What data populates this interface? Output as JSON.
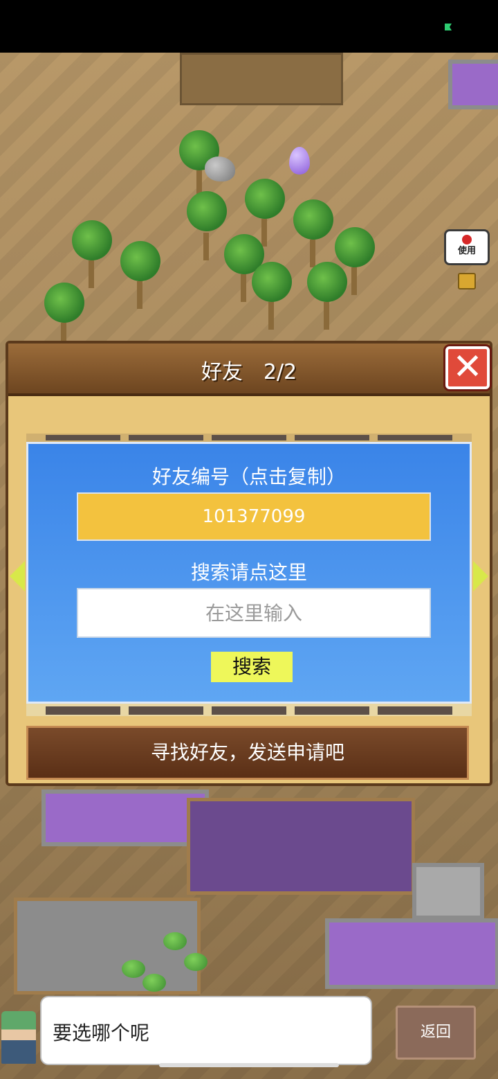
{
  "status_bar": {
    "battery_icon": "battery-charging-icon",
    "battery_color": "#2ecc71"
  },
  "map": {
    "use_item_label": "使用",
    "use_item_icon": "apple-icon",
    "lock_icon": "lock-icon",
    "egg_icon": "egg-icon"
  },
  "panel": {
    "title": "好友　2/2",
    "close_icon": "close-icon",
    "close_glyph": "✕",
    "prev_icon": "arrow-left-icon",
    "next_icon": "arrow-right-icon",
    "friend_id_label": "好友编号（点击复制）",
    "friend_id_value": "101377099",
    "search_label": "搜索请点这里",
    "search_placeholder": "在这里输入",
    "search_value": "",
    "search_button": "搜索",
    "find_friends_banner": "寻找好友，发送申请吧"
  },
  "dialog": {
    "text": "要选哪个呢",
    "back_button": "返回"
  },
  "colors": {
    "panel_bg": "#e8c67a",
    "header": "#6d4520",
    "friend_box": "#3a84e8",
    "id_field": "#f3c23e",
    "search_button": "#eef75a",
    "close_button": "#e04a3a"
  }
}
